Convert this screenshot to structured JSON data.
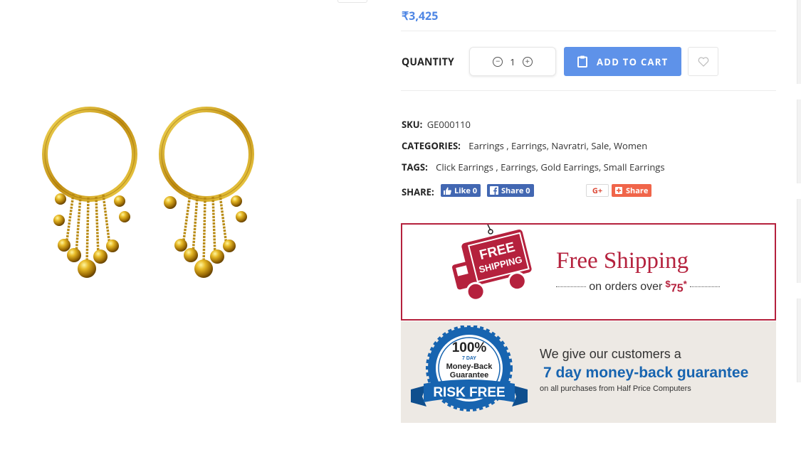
{
  "product": {
    "price": "₹3,425",
    "sku_label": "SKU:",
    "sku": "GE000110"
  },
  "quantity": {
    "label": "QUANTITY",
    "value": "1"
  },
  "actions": {
    "add_to_cart": "ADD TO CART"
  },
  "categories": {
    "label": "CATEGORIES:",
    "items": [
      "Earrings",
      "Earrings",
      "Navratri",
      "Sale",
      "Women"
    ]
  },
  "tags": {
    "label": "TAGS:",
    "items": [
      "Click Earrings",
      "Earrings",
      "Gold Earrings",
      "Small Earrings"
    ]
  },
  "share": {
    "label": "SHARE:",
    "fb_like": "Like 0",
    "fb_share": "Share 0",
    "gplus": "G+",
    "gshare": "Share"
  },
  "banner_shipping": {
    "sign_line1": "FREE",
    "sign_line2": "SHIPPING",
    "title": "Free Shipping",
    "sub_prefix": "on orders over",
    "sub_currency": "$",
    "sub_amount": "75",
    "sub_asterisk": "*"
  },
  "banner_guarantee": {
    "badge_percent": "100%",
    "badge_days": "7 DAY",
    "badge_line1": "Money-Back",
    "badge_line2": "Guarantee",
    "badge_ribbon": "RISK FREE",
    "line1": "We give our customers a",
    "line2": "7 day money-back guarantee",
    "line3": "on all purchases from Half Price Computers"
  },
  "colors": {
    "accent": "#5e92e9",
    "price": "#4e86e4",
    "shipping_red": "#b5213d",
    "guarantee_blue": "#1764b0",
    "facebook": "#4267b2",
    "google": "#f0654a"
  },
  "icons": [
    "minus-icon",
    "plus-icon",
    "clipboard-icon",
    "heart-icon",
    "facebook-icon",
    "google-share-icon",
    "truck-icon",
    "guarantee-badge"
  ]
}
